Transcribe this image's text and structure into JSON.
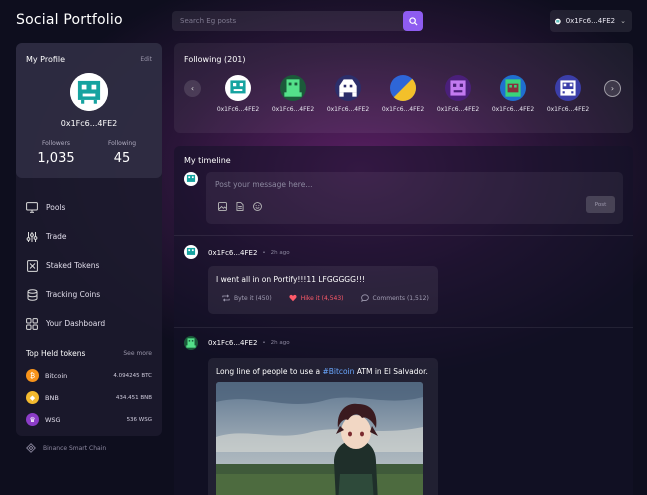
{
  "app": {
    "title": "Social Portfolio"
  },
  "search": {
    "placeholder": "Search Eg posts"
  },
  "account": {
    "name": "0x1Fc6...4FE2"
  },
  "profile": {
    "title": "My Profile",
    "edit_label": "Edit",
    "name": "0x1Fc6...4FE2",
    "followers_label": "Followers",
    "followers_value": "1,035",
    "following_label": "Following",
    "following_value": "45"
  },
  "nav": {
    "items": [
      {
        "label": "Pools",
        "icon": "monitor-icon"
      },
      {
        "label": "Trade",
        "icon": "sliders-icon"
      },
      {
        "label": "Staked Tokens",
        "icon": "stake-icon"
      },
      {
        "label": "Tracking Coins",
        "icon": "coins-icon"
      },
      {
        "label": "Your Dashboard",
        "icon": "grid-icon"
      }
    ]
  },
  "top_tokens": {
    "title": "Top Held tokens",
    "see_more": "See more",
    "items": [
      {
        "name": "Bitcoin",
        "amount": "4.094245 BTC",
        "color": "#f7931a",
        "glyph": "₿"
      },
      {
        "name": "BNB",
        "amount": "434.451 BNB",
        "color": "#f3ba2f",
        "glyph": "◆"
      },
      {
        "name": "WSG",
        "amount": "536 WSG",
        "color": "#8b3cc7",
        "glyph": "♛"
      }
    ]
  },
  "chain": {
    "label": "Binance Smart Chain"
  },
  "following": {
    "title": "Following (201)",
    "users": [
      {
        "name": "0x1Fc6...4FE2",
        "bg": "#ffffff",
        "fg": "#16a3a0"
      },
      {
        "name": "0x1Fc6...4FE2",
        "bg": "#1b5a3a",
        "fg": "#54e08a"
      },
      {
        "name": "0x1Fc6...4FE2",
        "bg": "#2c2e6a",
        "fg": "#ffffff"
      },
      {
        "name": "0x1Fc6...4FE2",
        "bg": "#2e66d8",
        "fg": "#f3c02a"
      },
      {
        "name": "0x1Fc6...4FE2",
        "bg": "#4a1f7a",
        "fg": "#c27af0"
      },
      {
        "name": "0x1Fc6...4FE2",
        "bg": "#1f6fcf",
        "fg": "#3ad27a"
      },
      {
        "name": "0x1Fc6...4FE2",
        "bg": "#3b3ea8",
        "fg": "#ffffff"
      }
    ]
  },
  "timeline": {
    "title": "My timeline",
    "composer_placeholder": "Post your message here...",
    "post_button": "Post"
  },
  "posts": [
    {
      "author": "0x1Fc6...4FE2",
      "time": "2h ago",
      "text": "I went all in on Portify!!!11 LFGGGGG!!!",
      "byte_label": "Byte it (450)",
      "like_label": "Hike it (4,543)",
      "comments_label": "Comments (1,512)"
    },
    {
      "author": "0x1Fc6...4FE2",
      "time": "2h ago",
      "text_before": "Long line of people to use a ",
      "hashtag": "#Bitcoin",
      "text_after": " ATM in El Salvador."
    }
  ],
  "colors": {
    "accent": "#8e5cf0",
    "like": "#ff5a6a",
    "hashtag": "#6aa8ff"
  }
}
